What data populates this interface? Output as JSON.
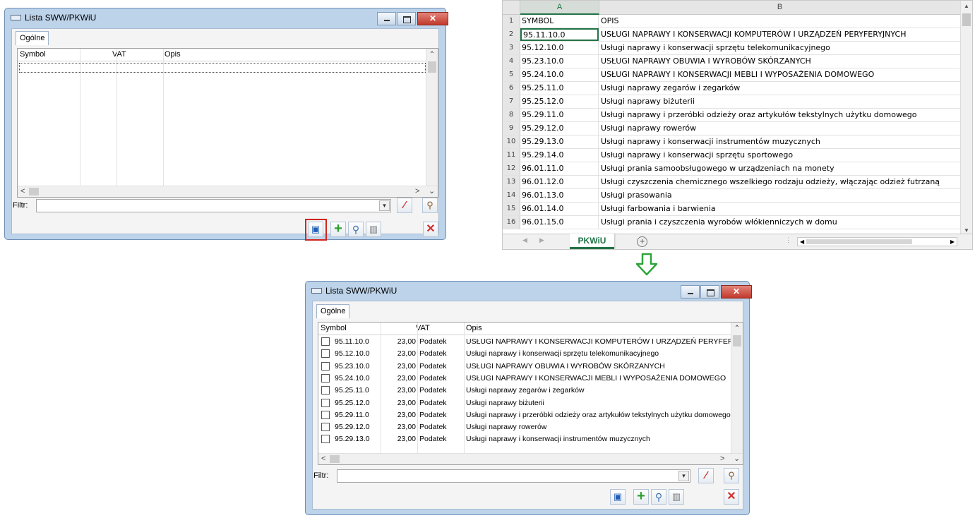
{
  "dialog": {
    "title": "Lista SWW/PKWiU",
    "tab": "Ogólne",
    "columns": {
      "symbol": "Symbol",
      "vat": "VAT",
      "opis": "Opis"
    },
    "filter_label": "Filtr:",
    "filter_value": ""
  },
  "spreadsheet": {
    "col_headers": [
      "A",
      "B"
    ],
    "sheet_tab": "PKWiU",
    "rows": [
      {
        "n": "1",
        "a": "SYMBOL",
        "b": "OPIS"
      },
      {
        "n": "2",
        "a": "95.11.10.0",
        "b": "USŁUGI NAPRAWY I KONSERWACJI KOMPUTERÓW I URZĄDZEŃ PERYFERYJNYCH"
      },
      {
        "n": "3",
        "a": "95.12.10.0",
        "b": "Usługi naprawy i konserwacji sprzętu telekomunikacyjnego"
      },
      {
        "n": "4",
        "a": "95.23.10.0",
        "b": "USŁUGI NAPRAWY OBUWIA I WYROBÓW SKÓRZANYCH"
      },
      {
        "n": "5",
        "a": "95.24.10.0",
        "b": "USŁUGI NAPRAWY I KONSERWACJI MEBLI I WYPOSAŻENIA DOMOWEGO"
      },
      {
        "n": "6",
        "a": "95.25.11.0",
        "b": "Usługi naprawy zegarów i zegarków"
      },
      {
        "n": "7",
        "a": "95.25.12.0",
        "b": "Usługi naprawy biżuterii"
      },
      {
        "n": "8",
        "a": "95.29.11.0",
        "b": "Usługi naprawy i przeróbki odzieży oraz artykułów tekstylnych użytku domowego"
      },
      {
        "n": "9",
        "a": "95.29.12.0",
        "b": "Usługi naprawy rowerów"
      },
      {
        "n": "10",
        "a": "95.29.13.0",
        "b": "Usługi naprawy i konserwacji instrumentów muzycznych"
      },
      {
        "n": "11",
        "a": "95.29.14.0",
        "b": "Usługi naprawy i konserwacji sprzętu sportowego"
      },
      {
        "n": "12",
        "a": "96.01.11.0",
        "b": "Usługi prania samoobsługowego w urządzeniach na monety"
      },
      {
        "n": "13",
        "a": "96.01.12.0",
        "b": "Usługi czyszczenia chemicznego wszelkiego rodzaju odzieży, włączając odzież futrzaną"
      },
      {
        "n": "14",
        "a": "96.01.13.0",
        "b": "Usługi prasowania"
      },
      {
        "n": "15",
        "a": "96.01.14.0",
        "b": "Usługi farbowania i barwienia"
      },
      {
        "n": "16",
        "a": "96.01.15.0",
        "b": "Usługi prania i czyszczenia wyrobów włókienniczych w domu"
      }
    ]
  },
  "result_rows": [
    {
      "symbol": "95.11.10.0",
      "vat": "23,00",
      "type": "Podatek",
      "opis": "USŁUGI NAPRAWY I KONSERWACJI KOMPUTERÓW I URZĄDZEŃ PERYFERYJNYCH"
    },
    {
      "symbol": "95.12.10.0",
      "vat": "23,00",
      "type": "Podatek",
      "opis": "Usługi naprawy i konserwacji sprzętu telekomunikacyjnego"
    },
    {
      "symbol": "95.23.10.0",
      "vat": "23,00",
      "type": "Podatek",
      "opis": "USŁUGI NAPRAWY OBUWIA I WYROBÓW SKÓRZANYCH"
    },
    {
      "symbol": "95.24.10.0",
      "vat": "23,00",
      "type": "Podatek",
      "opis": "USŁUGI NAPRAWY I KONSERWACJI MEBLI I WYPOSAŻENIA DOMOWEGO"
    },
    {
      "symbol": "95.25.11.0",
      "vat": "23,00",
      "type": "Podatek",
      "opis": "Usługi naprawy zegarów i zegarków"
    },
    {
      "symbol": "95.25.12.0",
      "vat": "23,00",
      "type": "Podatek",
      "opis": "Usługi naprawy biżuterii"
    },
    {
      "symbol": "95.29.11.0",
      "vat": "23,00",
      "type": "Podatek",
      "opis": "Usługi naprawy i przeróbki odzieży oraz artykułów tekstylnych użytku domowego"
    },
    {
      "symbol": "95.29.12.0",
      "vat": "23,00",
      "type": "Podatek",
      "opis": "Usługi naprawy rowerów"
    },
    {
      "symbol": "95.29.13.0",
      "vat": "23,00",
      "type": "Podatek",
      "opis": "Usługi naprawy i konserwacji instrumentów muzycznych"
    }
  ],
  "icons": {
    "import": "import-excel-icon",
    "add": "plus-icon",
    "search": "magnifier-icon",
    "delete": "trash-icon",
    "close": "close-x-icon",
    "filter_clear": "eraser-icon",
    "filter_advanced": "key-icon",
    "transition": "arrow-down-icon"
  },
  "colors": {
    "excel_green": "#217346",
    "highlight_red": "#d0261f",
    "arrow_green": "#2ea43a"
  }
}
